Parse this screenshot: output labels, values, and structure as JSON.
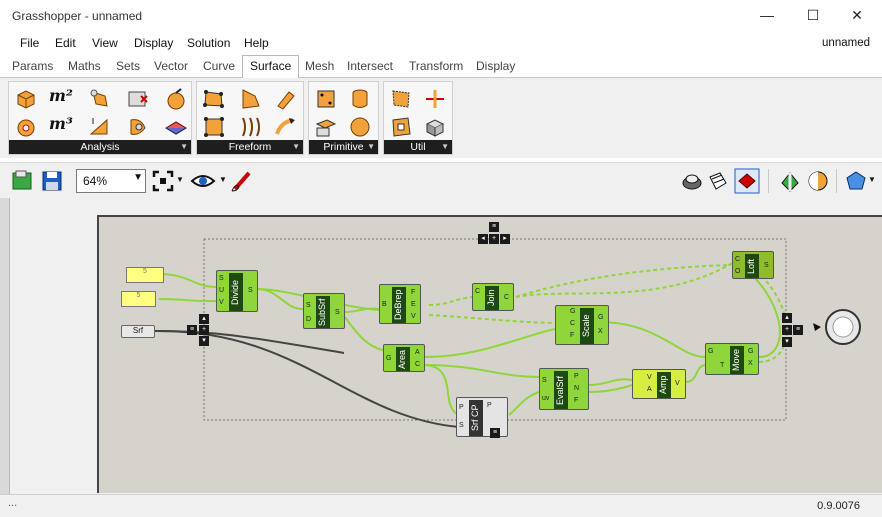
{
  "window": {
    "title": "Grasshopper - unnamed",
    "minimize": "—",
    "maximize": "☐",
    "close": "✕"
  },
  "menu": {
    "items": [
      "File",
      "Edit",
      "View",
      "Display",
      "Solution",
      "Help"
    ],
    "doc_name": "unnamed"
  },
  "tabs": {
    "items": [
      "Params",
      "Maths",
      "Sets",
      "Vector",
      "Curve",
      "Surface",
      "Mesh",
      "Intersect",
      "Transform",
      "Display"
    ],
    "active": "Surface"
  },
  "ribbon": {
    "groups": [
      "Analysis",
      "Freeform",
      "Primitive",
      "Util"
    ]
  },
  "toolbar": {
    "zoom": "64%"
  },
  "canvas": {
    "panels": [
      "5",
      "5"
    ],
    "srf_param": "Srf",
    "nodes": [
      {
        "id": "divide",
        "label": "Divide",
        "inputs": [
          "S",
          "U",
          "V"
        ],
        "outputs": [
          "S"
        ]
      },
      {
        "id": "subsrf",
        "label": "SubSrf",
        "inputs": [
          "S",
          "D"
        ],
        "outputs": [
          "S"
        ]
      },
      {
        "id": "debrep",
        "label": "DeBrep",
        "inputs": [
          "B"
        ],
        "outputs": [
          "F",
          "E",
          "V"
        ]
      },
      {
        "id": "join",
        "label": "Join",
        "inputs": [
          "C"
        ],
        "outputs": [
          "C"
        ]
      },
      {
        "id": "scale",
        "label": "Scale",
        "inputs": [
          "G",
          "C",
          "F"
        ],
        "outputs": [
          "G",
          "X"
        ]
      },
      {
        "id": "area",
        "label": "Area",
        "inputs": [
          "G"
        ],
        "outputs": [
          "A",
          "C"
        ]
      },
      {
        "id": "srfcp",
        "label": "Srf CP",
        "inputs": [
          "P",
          "S"
        ],
        "outputs": [
          "P"
        ]
      },
      {
        "id": "evalsrf",
        "label": "EvalSrf",
        "inputs": [
          "S",
          "uv"
        ],
        "outputs": [
          "P",
          "N",
          "F"
        ]
      },
      {
        "id": "amp",
        "label": "Amp",
        "inputs": [
          "V",
          "A"
        ],
        "outputs": [
          "V"
        ]
      },
      {
        "id": "move",
        "label": "Move",
        "inputs": [
          "G",
          "T"
        ],
        "outputs": [
          "G",
          "X"
        ]
      },
      {
        "id": "loft",
        "label": "Loft",
        "inputs": [
          "C",
          "O"
        ],
        "outputs": [
          "S"
        ]
      }
    ]
  },
  "status": {
    "version": "0.9.0076",
    "left": "..."
  },
  "colors": {
    "node_green": "#8fd63a",
    "node_label": "#1e4a12",
    "wire": "#8fd63a",
    "canvas_bg": "#d6d3cc"
  }
}
